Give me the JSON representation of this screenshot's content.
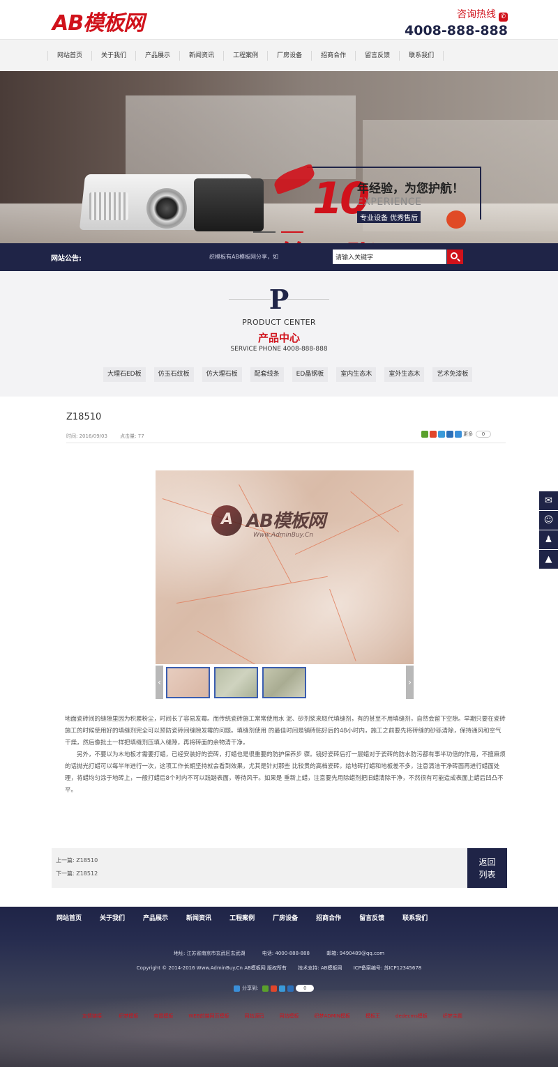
{
  "header": {
    "logo": "AB模板网",
    "hotline_label": "咨询热线",
    "hotline_number": "4008-888-888"
  },
  "nav": {
    "items": [
      "网站首页",
      "关于我们",
      "产品展示",
      "新闻资讯",
      "工程案例",
      "厂房设备",
      "招商合作",
      "留言反馈",
      "联系我们"
    ]
  },
  "banner": {
    "number": "10",
    "title": "年经验，为您护航！",
    "subtitle": "EXPERIENCE",
    "tag": "专业设备 优秀售后",
    "big_text": "第二张"
  },
  "notice": {
    "label": "网站公告:",
    "text": "织模板有AB模板网分享，如",
    "search_placeholder": "请输入关键字"
  },
  "product_center": {
    "letter": "P",
    "en": "PRODUCT CENTER",
    "cn": "产品中心",
    "service": "SERVICE PHONE 4008-888-888",
    "categories": [
      "大理石ED板",
      "仿玉石纹板",
      "仿大理石板",
      "配套线条",
      "ED晶钢板",
      "室内生态木",
      "室外生态木",
      "艺术免漆板"
    ]
  },
  "article": {
    "title": "Z18510",
    "time": "时间: 2016/09/03",
    "views": "点击量: 77",
    "share_more": "更多",
    "share_count": "0",
    "watermark_sub": "Www.AdminBuy.Cn",
    "paragraph1": "地面瓷砖间的缝隙里因为积累粉尘，时间长了容易发霉。而传统瓷砖施工常常使用水 泥、砂剂浆来取代填缝剂，有的甚至不用填缝剂，自然会留下空隙。早期只要在瓷砖施工的时候使用好的填缝剂完全可以预防瓷砖间缝隙发霉的问题。填缝剂使用 的最佳时间是铺砖贴好后的48小时内，施工之前要先将砖缝的砂砾清除，保持通风和空气干燥，然后像批土一样把填缝剂压填入缝隙，再将砖面的余物清干净。",
    "paragraph2": "另外，不要以为木地板才需要打蜡，已经安装好的瓷砖，打蜡也是很重要的防护保养步 骤。镜好瓷砖后打一层蜡对于瓷砖的防水防污都有事半功倍的作用，不擅麻烦的话抛光打蜡可以每半年进行一次，这项工作长期坚持就会看到效果，尤其是针对那些 比较贵的高档瓷砖。给地砖打蜡和地板差不多，注意清洁干净砖面再进行蜡面处理，将蜡均匀涂于地砖上，一般打蜡后8个时内不可以践踏表面，等待风干。如果是 重新上蜡，注意要先用除蜡剂把旧蜡清除干净，不然很有可能造成表面上蜡后凹凸不平。",
    "prev": "上一篇: Z18510",
    "next": "下一篇: Z18512",
    "back_line1": "返回",
    "back_line2": "列表"
  },
  "footer": {
    "nav": [
      "网站首页",
      "关于我们",
      "产品展示",
      "新闻资讯",
      "工程案例",
      "厂房设备",
      "招商合作",
      "留言反馈",
      "联系我们"
    ],
    "address": "地址: 江苏省南京市玄武区玄武湖",
    "phone": "电话: 4000-888-888",
    "email": "邮箱: 9490489@qq.com",
    "copyright": "Copyright © 2014-2016 Www.AdminBuy.Cn AB模板网 版权所有",
    "tech": "技术支持: AB模板网",
    "icp": "ICP备案编号: 苏ICP12345678",
    "share_label": "分享到:",
    "share_count": "0",
    "links": [
      "友情链接:",
      "织梦模板",
      "帝国模板",
      "WEB前端网页模板",
      "网站源码",
      "网站模板",
      "织梦ADMIN模板",
      "模板王",
      "dedecms模板",
      "织梦主题"
    ]
  },
  "side_icons": [
    "chat-icon",
    "users-icon",
    "qq-icon",
    "top-arrow-icon"
  ],
  "colors": {
    "brand_red": "#d0121b",
    "navy": "#1f2447"
  }
}
